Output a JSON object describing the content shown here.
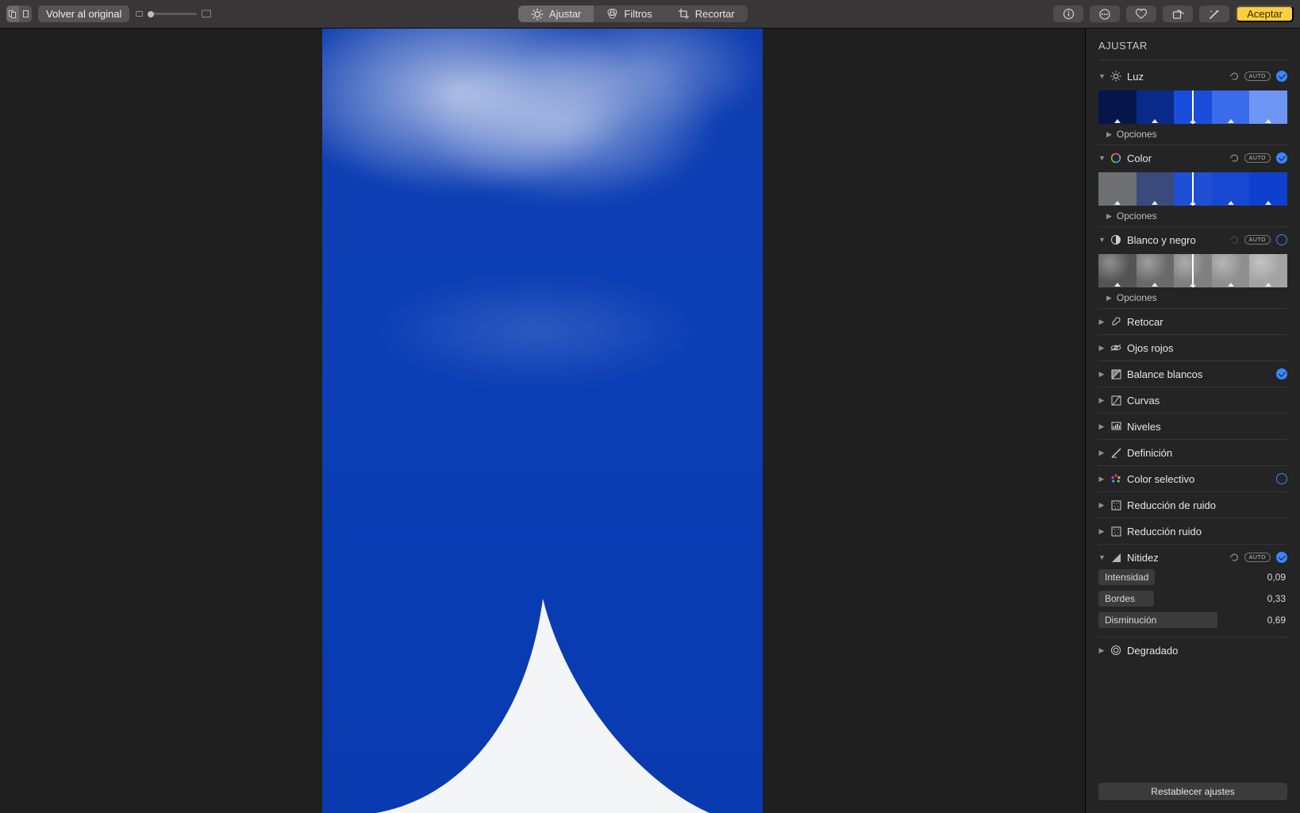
{
  "toolbar": {
    "revert": "Volver al original",
    "tabs": {
      "adjust": "Ajustar",
      "filters": "Filtros",
      "crop": "Recortar"
    },
    "accept": "Aceptar"
  },
  "sidebar": {
    "title": "AJUSTAR",
    "auto_label": "AUTO",
    "options_label": "Opciones",
    "reset_all": "Restablecer ajustes",
    "sections": {
      "light": {
        "name": "Luz"
      },
      "color": {
        "name": "Color"
      },
      "bw": {
        "name": "Blanco y negro"
      },
      "retouch": {
        "name": "Retocar"
      },
      "redeye": {
        "name": "Ojos rojos"
      },
      "wb": {
        "name": "Balance blancos"
      },
      "curves": {
        "name": "Curvas"
      },
      "levels": {
        "name": "Niveles"
      },
      "definition": {
        "name": "Definición"
      },
      "selcolor": {
        "name": "Color selectivo"
      },
      "noise1": {
        "name": "Reducción de ruido"
      },
      "noise2": {
        "name": "Reducción ruido"
      },
      "sharpen": {
        "name": "Nitidez",
        "intensity_label": "Intensidad",
        "intensity_val": "0,09",
        "edges_label": "Bordes",
        "edges_val": "0,33",
        "falloff_label": "Disminución",
        "falloff_val": "0,69"
      },
      "vignette": {
        "name": "Degradado"
      }
    }
  }
}
